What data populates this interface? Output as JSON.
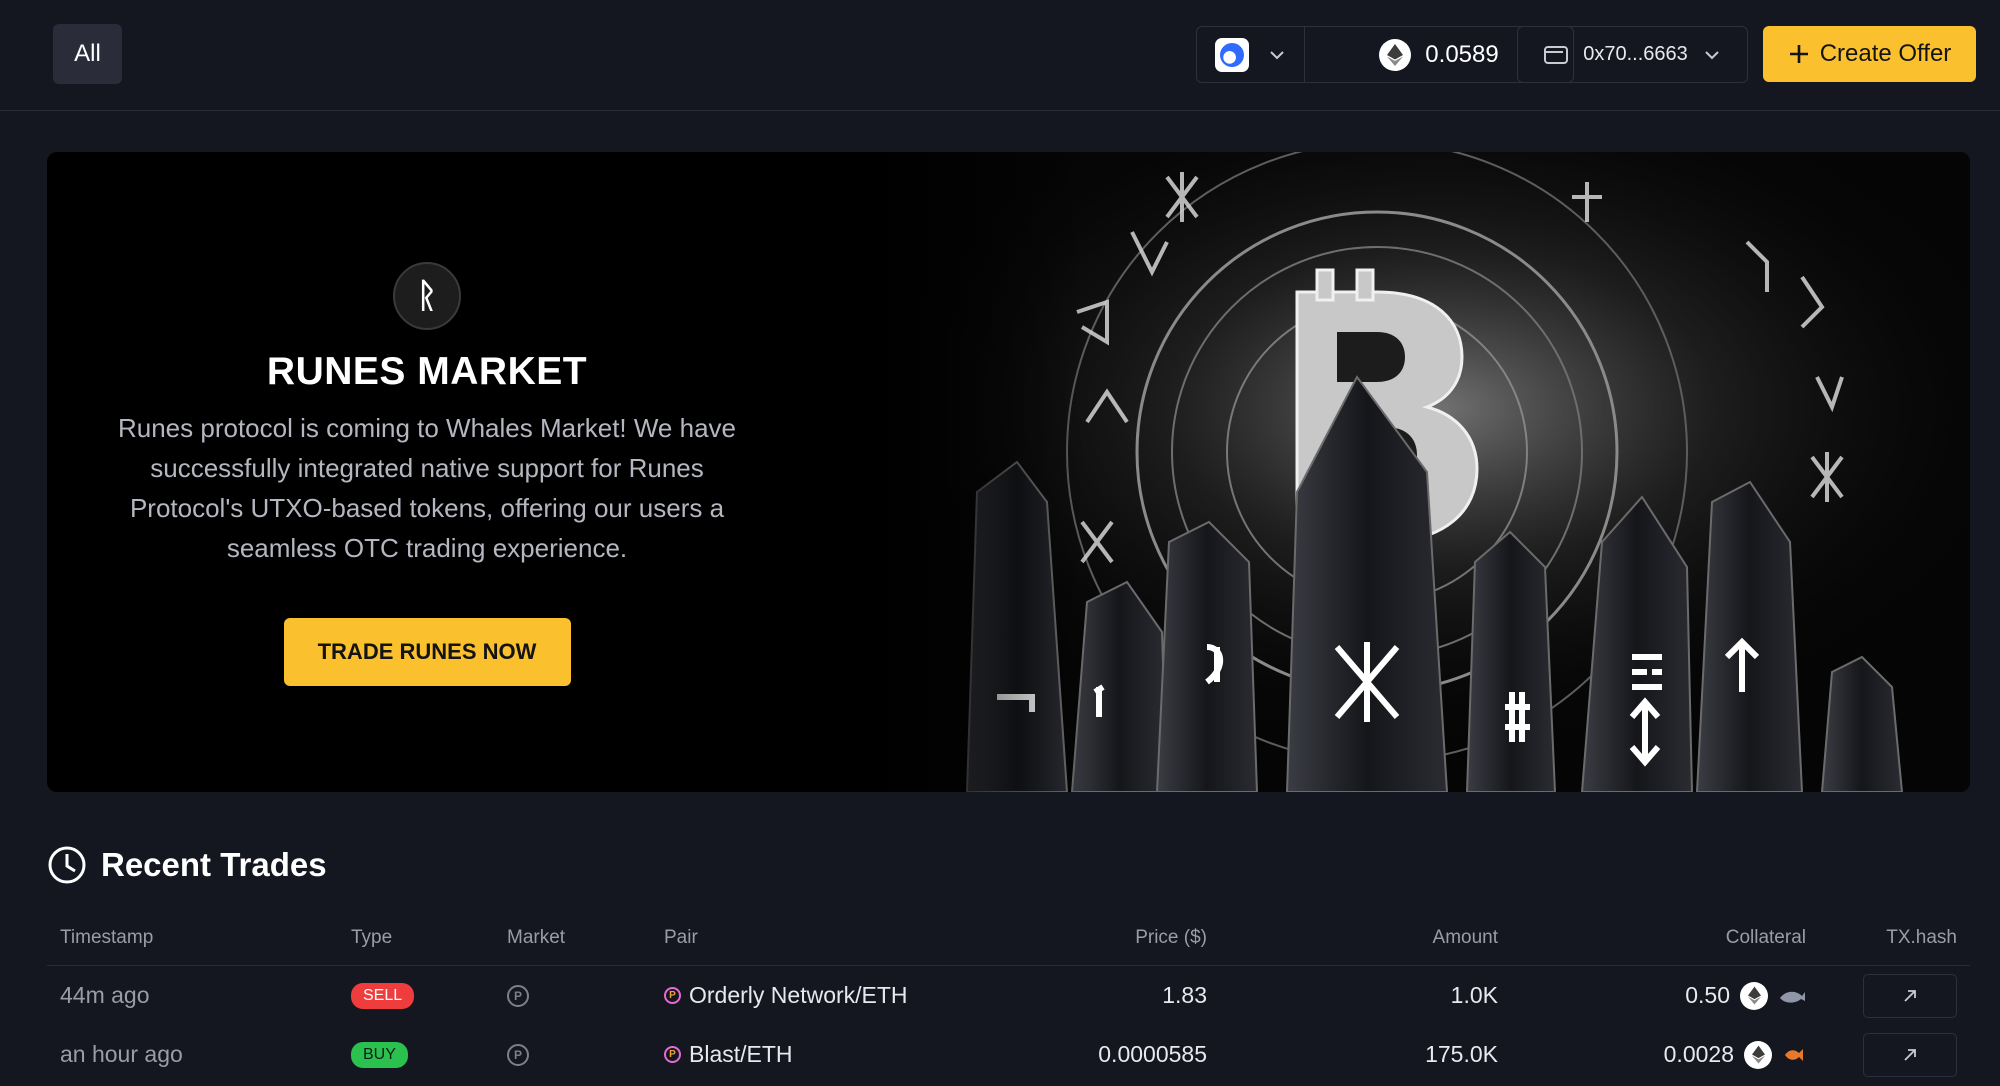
{
  "header": {
    "filter_label": "All",
    "balance": "0.0589",
    "wallet_address": "0x70...6663",
    "create_offer_label": "Create Offer"
  },
  "banner": {
    "title": "RUNES MARKET",
    "description": "Runes protocol is coming to Whales Market! We have successfully integrated native support for Runes Protocol's UTXO-based tokens, offering our users a seamless OTC trading experience.",
    "cta_label": "TRADE RUNES NOW"
  },
  "recent_trades": {
    "title": "Recent Trades",
    "columns": {
      "timestamp": "Timestamp",
      "type": "Type",
      "market": "Market",
      "pair": "Pair",
      "price": "Price ($)",
      "amount": "Amount",
      "collateral": "Collateral",
      "txhash": "TX.hash"
    },
    "rows": [
      {
        "timestamp": "44m ago",
        "type": "SELL",
        "pair": "Orderly Network/ETH",
        "price": "1.83",
        "amount": "1.0K",
        "collateral": "0.50"
      },
      {
        "timestamp": "an hour ago",
        "type": "BUY",
        "pair": "Blast/ETH",
        "price": "0.0000585",
        "amount": "175.0K",
        "collateral": "0.0028"
      }
    ]
  },
  "colors": {
    "background": "#141620",
    "accent": "#fbc02d",
    "sell": "#ef3d3d",
    "buy": "#2bc14f"
  },
  "icons": [
    "chain-icon",
    "chevron-down-icon",
    "eth-icon",
    "wallet-icon",
    "plus-icon",
    "runes-logo",
    "clock-icon",
    "points-icon",
    "external-link-icon"
  ]
}
